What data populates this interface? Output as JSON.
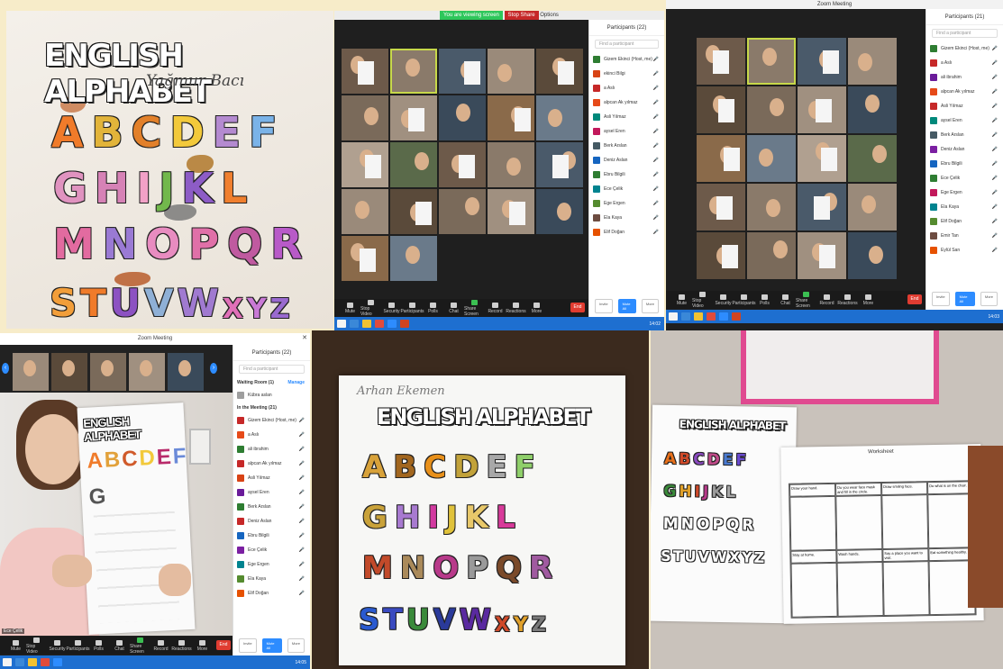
{
  "panel1": {
    "title": "ENGLISH ALPHABET",
    "name": "Yağmur Bacı",
    "rows": [
      [
        "A",
        "B",
        "C",
        "D",
        "E",
        "F"
      ],
      [
        "G",
        "H",
        "I",
        "J",
        "K",
        "L"
      ],
      [
        "M",
        "N",
        "O",
        "P",
        "Q",
        "R"
      ],
      [
        "S",
        "T",
        "U",
        "V",
        "W",
        "X",
        "Y",
        "Z"
      ]
    ]
  },
  "panel2": {
    "topbar_green": "You are viewing screen",
    "topbar_red": "Stop Share",
    "topbar_text": "Options",
    "side_title": "Participants (22)",
    "search": "Find a participant",
    "participants": [
      "Gizem Ekinci (Host, me)",
      "ekinci Bilgi",
      "a Aslı",
      "alpcan Ak yılmaz",
      "Asli Yılmaz",
      "aysel Eren",
      "Berk Arslan",
      "Deniz Aslan",
      "Ebru Bilgili",
      "Ece Çelik",
      "Ege Ergen",
      "Ela Kaya",
      "Elif Doğan"
    ],
    "avatar_colors": [
      "#2e7d32",
      "#d84315",
      "#c62828",
      "#e64a19",
      "#00897b",
      "#c2185b",
      "#455a64",
      "#1565c0",
      "#2e7d32",
      "#00838f",
      "#558b2f",
      "#6d4c41",
      "#e65100"
    ],
    "foot": [
      "Invite",
      "Mute All",
      "More"
    ],
    "controls": [
      "Mute",
      "Stop Video",
      "Security",
      "Participants",
      "Polls",
      "Chat",
      "Share Screen",
      "Record",
      "Reactions",
      "More"
    ],
    "end": "End",
    "clock": "14:02"
  },
  "panel3": {
    "window_title": "Zoom Meeting",
    "side_title": "Participants (21)",
    "search": "Find a participant",
    "participants": [
      "Gizem Ekinci (Host, me)",
      "a Aslı",
      "ali ibrahim",
      "alpcan Ak yılmaz",
      "Asli Yılmaz",
      "aysel Eren",
      "Berk Arslan",
      "Deniz Aslan",
      "Ebru Bilgili",
      "Ece Çelik",
      "Ege Ergen",
      "Ela Kaya",
      "Elif Doğan",
      "Emir Tan",
      "Eylül Sarı"
    ],
    "avatar_colors": [
      "#2e7d32",
      "#c62828",
      "#6a1b9a",
      "#e64a19",
      "#c62828",
      "#00897b",
      "#455a64",
      "#7b1fa2",
      "#1565c0",
      "#2e7d32",
      "#c2185b",
      "#00838f",
      "#558b2f",
      "#6d4c41",
      "#e65100"
    ],
    "foot": [
      "Invite",
      "Mute All",
      "More"
    ],
    "controls": [
      "Mute",
      "Stop Video",
      "Security",
      "Participants",
      "Polls",
      "Chat",
      "Share Screen",
      "Record",
      "Reactions",
      "More"
    ],
    "end": "End",
    "clock": "14:03"
  },
  "panel4": {
    "window_title": "Zoom Meeting",
    "side_title": "Participants (22)",
    "search": "Find a participant",
    "waiting": "Waiting Room (1)",
    "admit": "Manage",
    "waiting_person": "Kübra aslan",
    "in_meeting": "In the Meeting (21)",
    "participants": [
      "Gizem Ekinci (Host, me)",
      "a Aslı",
      "ali ibrahim",
      "alpcan Ak yılmaz",
      "Asli Yılmaz",
      "aysel Eren",
      "Berk Arslan",
      "Deniz Aslan",
      "Ebru Bilgili",
      "Ece Çelik",
      "Ege Ergen",
      "Ela Kaya",
      "Elif Doğan"
    ],
    "avatar_colors": [
      "#c62828",
      "#e64a19",
      "#2e7d32",
      "#c62828",
      "#d84315",
      "#6a1b9a",
      "#2e7d32",
      "#c62828",
      "#1565c0",
      "#7b1fa2",
      "#00838f",
      "#558b2f",
      "#e65100"
    ],
    "speaker": "Ece Çelik",
    "paper_title": "ENGLISH ALPHABET",
    "foot": [
      "Invite",
      "Mute All",
      "More"
    ],
    "controls": [
      "Mute",
      "Stop Video",
      "Security",
      "Participants",
      "Polls",
      "Chat",
      "Share Screen",
      "Record",
      "Reactions",
      "More"
    ],
    "end": "End",
    "clock": "14:05"
  },
  "panel5": {
    "name": "Arhan Ekemen",
    "title": "ENGLISH ALPHABET",
    "rows": [
      [
        "A",
        "B",
        "C",
        "D",
        "E",
        "F"
      ],
      [
        "G",
        "H",
        "I",
        "J",
        "K",
        "L"
      ],
      [
        "M",
        "N",
        "O",
        "P",
        "Q",
        "R"
      ],
      [
        "S",
        "T",
        "U",
        "V",
        "W",
        "X",
        "Y",
        "Z"
      ]
    ]
  },
  "panel6": {
    "title": "ENGLISH ALPHABET",
    "rows": [
      [
        "A",
        "B",
        "C",
        "D",
        "E",
        "F"
      ],
      [
        "G",
        "H",
        "I",
        "J",
        "K",
        "L"
      ],
      [
        "M",
        "N",
        "O",
        "P",
        "Q",
        "R"
      ],
      [
        "S",
        "T",
        "U",
        "V",
        "W",
        "X",
        "Y",
        "Z"
      ]
    ],
    "worksheet_title": "Worksheet",
    "cells": [
      "Draw your hand.",
      "Do you wear face mask and fill in the circle.",
      "Draw smiling face.",
      "Do what is on the chair.",
      "Stay at home.",
      "Wash hands.",
      "Say a place you want to visit.",
      "Eat something healthy."
    ]
  }
}
